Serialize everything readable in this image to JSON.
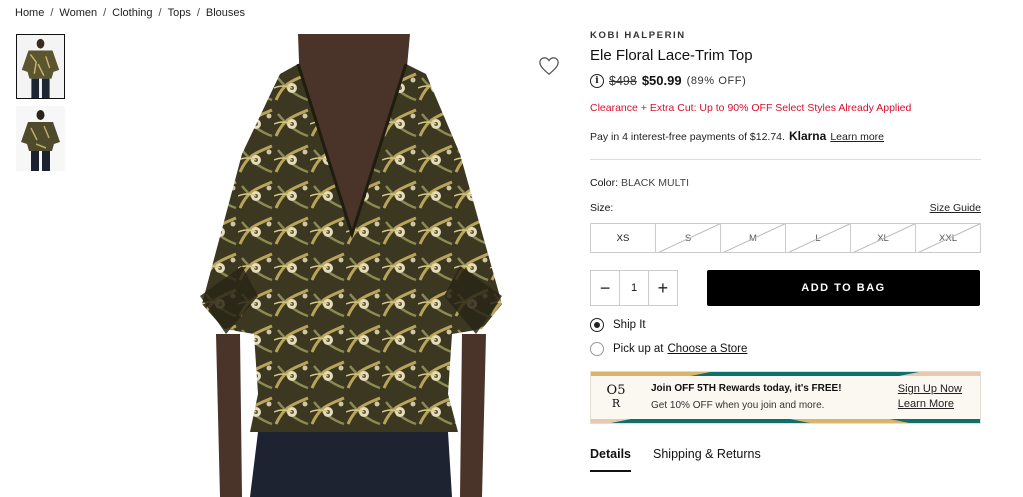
{
  "breadcrumb": [
    "Home",
    "Women",
    "Clothing",
    "Tops",
    "Blouses"
  ],
  "breadcrumb_separator": "/",
  "product": {
    "brand": "KOBI HALPERIN",
    "title": "Ele Floral Lace-Trim Top",
    "info_icon": "i",
    "original_price": "$498",
    "sale_price": "$50.99",
    "discount": "(89% OFF)",
    "promo": "Clearance + Extra Cut: Up to 90% OFF Select Styles Already Applied",
    "klarna": {
      "text": "Pay in 4 interest-free payments of $12.74.",
      "logo": "Klarna",
      "link": "Learn more"
    },
    "color_label": "Color:",
    "color_value": "BLACK MULTI",
    "size_label": "Size:",
    "size_guide": "Size Guide",
    "sizes": [
      {
        "label": "XS",
        "available": true
      },
      {
        "label": "S",
        "available": false
      },
      {
        "label": "M",
        "available": false
      },
      {
        "label": "L",
        "available": false
      },
      {
        "label": "XL",
        "available": false
      },
      {
        "label": "XXL",
        "available": false
      }
    ],
    "quantity": "1",
    "qty_minus": "−",
    "qty_plus": "+",
    "add_to_bag": "ADD TO BAG",
    "ship_it": "Ship It",
    "pickup": "Pick up at",
    "choose_store": "Choose a Store"
  },
  "rewards": {
    "logo_top": "O5",
    "logo_bottom": "R",
    "headline": "Join OFF 5TH Rewards today, it's FREE!",
    "subline": "Get 10% OFF when you join and more.",
    "sign_up": "Sign Up Now",
    "learn_more": "Learn More"
  },
  "tabs": [
    "Details",
    "Shipping & Returns"
  ],
  "icons": {
    "wishlist": "heart-icon",
    "info": "info-icon"
  },
  "colors": {
    "promo_red": "#d6102d",
    "button_black": "#000000",
    "rewards_teal": "#0f6f6a",
    "rewards_gold": "#d9b46a"
  }
}
